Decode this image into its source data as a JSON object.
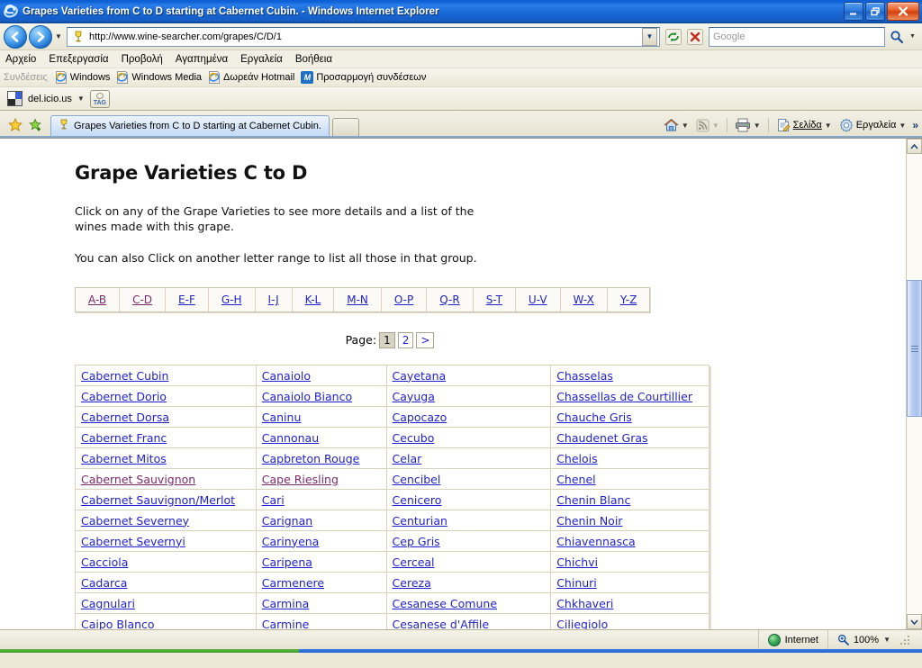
{
  "window": {
    "title": "Grapes Varieties from C to D starting at Cabernet Cubin. - Windows Internet Explorer",
    "minimize_label": "_",
    "restore_label": "❐",
    "close_label": "✕"
  },
  "addressbar": {
    "url": "http://www.wine-searcher.com/grapes/C/D/1",
    "dropdown_caret": "▼",
    "refresh_label": "↻",
    "stop_label": "✕",
    "search_placeholder": "Google",
    "search_caret": "▼"
  },
  "menu": {
    "items": [
      {
        "label": "Αρχείο"
      },
      {
        "label": "Επεξεργασία"
      },
      {
        "label": "Προβολή"
      },
      {
        "label": "Αγαπημένα"
      },
      {
        "label": "Εργαλεία"
      },
      {
        "label": "Βοήθεια"
      }
    ]
  },
  "links": {
    "label": "Συνδέσεις",
    "items": [
      {
        "label": "Windows",
        "icon": "ie-icon"
      },
      {
        "label": "Windows Media",
        "icon": "ie-icon"
      },
      {
        "label": "Δωρεάν Hotmail",
        "icon": "ie-icon"
      },
      {
        "label": "Προσαρμογή συνδέσεων",
        "icon": "msn-icon"
      }
    ]
  },
  "delicious": {
    "label": "del.icio.us",
    "caret": "▼",
    "tag_label": "TAG"
  },
  "tabs": {
    "favorites_icon": "star-icon",
    "add_favorite_icon": "add-star-icon",
    "items": [
      {
        "label": "Grapes Varieties from C to D starting at Cabernet Cubin.",
        "icon": "wine-glass-icon",
        "active": true
      }
    ],
    "new_tab_label": ""
  },
  "toolbar_right": {
    "home_label": "",
    "home_caret": "▼",
    "feeds_label": "",
    "feeds_caret": "▼",
    "print_label": "",
    "print_caret": "▼",
    "page_label": "Σελίδα",
    "page_caret": "▼",
    "tools_label": "Εργαλεία",
    "tools_caret": "▼",
    "overflow_label": "»"
  },
  "page": {
    "title": "Grape Varieties C to D",
    "paragraph1": "Click on any of the Grape Varieties to see more details and a list of the wines made with this grape.",
    "paragraph2": "You can also Click on another letter range to list all those in that group.",
    "letter_ranges": [
      {
        "label": "A-B",
        "visited": true
      },
      {
        "label": "C-D",
        "visited": true
      },
      {
        "label": "E-F",
        "visited": false
      },
      {
        "label": "G-H",
        "visited": false
      },
      {
        "label": "I-J",
        "visited": false
      },
      {
        "label": "K-L",
        "visited": false
      },
      {
        "label": "M-N",
        "visited": false
      },
      {
        "label": "O-P",
        "visited": false
      },
      {
        "label": "Q-R",
        "visited": false
      },
      {
        "label": "S-T",
        "visited": false
      },
      {
        "label": "U-V",
        "visited": false
      },
      {
        "label": "W-X",
        "visited": false
      },
      {
        "label": "Y-Z",
        "visited": false
      }
    ],
    "pager": {
      "label": "Page:",
      "pages": [
        {
          "label": "1",
          "current": true
        },
        {
          "label": "2",
          "current": false
        },
        {
          "label": ">",
          "current": false
        }
      ]
    },
    "grape_rows": [
      [
        {
          "label": "Cabernet Cubin",
          "visited": false
        },
        {
          "label": "Canaiolo",
          "visited": false
        },
        {
          "label": "Cayetana",
          "visited": false
        },
        {
          "label": "Chasselas",
          "visited": false
        }
      ],
      [
        {
          "label": "Cabernet Dorio",
          "visited": false
        },
        {
          "label": "Canaiolo Bianco",
          "visited": false
        },
        {
          "label": "Cayuga",
          "visited": false
        },
        {
          "label": "Chassellas de Courtillier",
          "visited": false
        }
      ],
      [
        {
          "label": "Cabernet Dorsa",
          "visited": false
        },
        {
          "label": "Caninu",
          "visited": false
        },
        {
          "label": "Capocazo",
          "visited": false
        },
        {
          "label": "Chauche Gris",
          "visited": false
        }
      ],
      [
        {
          "label": "Cabernet Franc",
          "visited": false
        },
        {
          "label": "Cannonau",
          "visited": false
        },
        {
          "label": "Cecubo",
          "visited": false
        },
        {
          "label": "Chaudenet Gras",
          "visited": false
        }
      ],
      [
        {
          "label": "Cabernet Mitos",
          "visited": false
        },
        {
          "label": "Capbreton Rouge",
          "visited": false
        },
        {
          "label": "Celar",
          "visited": false
        },
        {
          "label": "Chelois",
          "visited": false
        }
      ],
      [
        {
          "label": "Cabernet Sauvignon",
          "visited": true
        },
        {
          "label": "Cape Riesling",
          "visited": true
        },
        {
          "label": "Cencibel",
          "visited": false
        },
        {
          "label": "Chenel",
          "visited": false
        }
      ],
      [
        {
          "label": "Cabernet Sauvignon/Merlot",
          "visited": false
        },
        {
          "label": "Cari",
          "visited": false
        },
        {
          "label": "Cenicero",
          "visited": false
        },
        {
          "label": "Chenin Blanc",
          "visited": false
        }
      ],
      [
        {
          "label": "Cabernet Severney",
          "visited": false
        },
        {
          "label": "Carignan",
          "visited": false
        },
        {
          "label": "Centurian",
          "visited": false
        },
        {
          "label": "Chenin Noir",
          "visited": false
        }
      ],
      [
        {
          "label": "Cabernet Severnyi",
          "visited": false
        },
        {
          "label": "Carinyena",
          "visited": false
        },
        {
          "label": "Cep Gris",
          "visited": false
        },
        {
          "label": "Chiavennasca",
          "visited": false
        }
      ],
      [
        {
          "label": "Cacciola",
          "visited": false
        },
        {
          "label": "Caripena",
          "visited": false
        },
        {
          "label": "Cerceal",
          "visited": false
        },
        {
          "label": "Chichvi",
          "visited": false
        }
      ],
      [
        {
          "label": "Cadarca",
          "visited": false
        },
        {
          "label": "Carmenere",
          "visited": false
        },
        {
          "label": "Cereza",
          "visited": false
        },
        {
          "label": "Chinuri",
          "visited": false
        }
      ],
      [
        {
          "label": "Cagnulari",
          "visited": false
        },
        {
          "label": "Carmina",
          "visited": false
        },
        {
          "label": "Cesanese Comune",
          "visited": false
        },
        {
          "label": "Chkhaveri",
          "visited": false
        }
      ],
      [
        {
          "label": "Caipo Blanco",
          "visited": false
        },
        {
          "label": "Carmine",
          "visited": false
        },
        {
          "label": "Cesanese d'Affile",
          "visited": false
        },
        {
          "label": "Ciliegiolo",
          "visited": false
        }
      ]
    ]
  },
  "statusbar": {
    "zone": "Internet",
    "zoom": "100%",
    "zoom_caret": "▼"
  },
  "colors": {
    "link": "#2222cc",
    "link_visited": "#7a2a6a",
    "title_bar": "#1560cd",
    "page_bg": "#ffffff"
  }
}
